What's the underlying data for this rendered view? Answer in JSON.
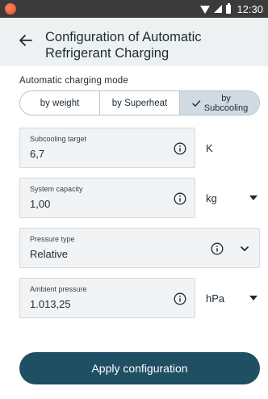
{
  "status_bar": {
    "time": "12:30",
    "icons": [
      "app-logo-icon",
      "wifi-icon",
      "signal-icon",
      "battery-icon"
    ]
  },
  "header": {
    "title": "Configuration of Automatic Refrigerant Charging",
    "back_icon": "arrow-left-icon"
  },
  "charging_mode": {
    "label": "Automatic charging mode",
    "options": [
      {
        "label": "by weight",
        "selected": false
      },
      {
        "label": "by Superheat",
        "selected": false
      },
      {
        "label": "by Subcooling",
        "label_line1": "by",
        "label_line2": "Subcooling",
        "selected": true
      }
    ]
  },
  "fields": {
    "subcooling_target": {
      "label": "Subcooling target",
      "value": "6,7",
      "unit": "K"
    },
    "system_capacity": {
      "label": "System capacity",
      "value": "1,00",
      "unit": "kg"
    },
    "pressure_type": {
      "label": "Pressure type",
      "value": "Relative"
    },
    "ambient_pressure": {
      "label": "Ambient pressure",
      "value": "1.013,25",
      "unit": "hPa"
    }
  },
  "apply_label": "Apply configuration",
  "colors": {
    "status_bar": "#3b3b3b",
    "header_bg": "#eef1f2",
    "selected_segment": "#cfdbe0",
    "field_bg": "#f1f3f4",
    "primary_button": "#1f4f63"
  }
}
